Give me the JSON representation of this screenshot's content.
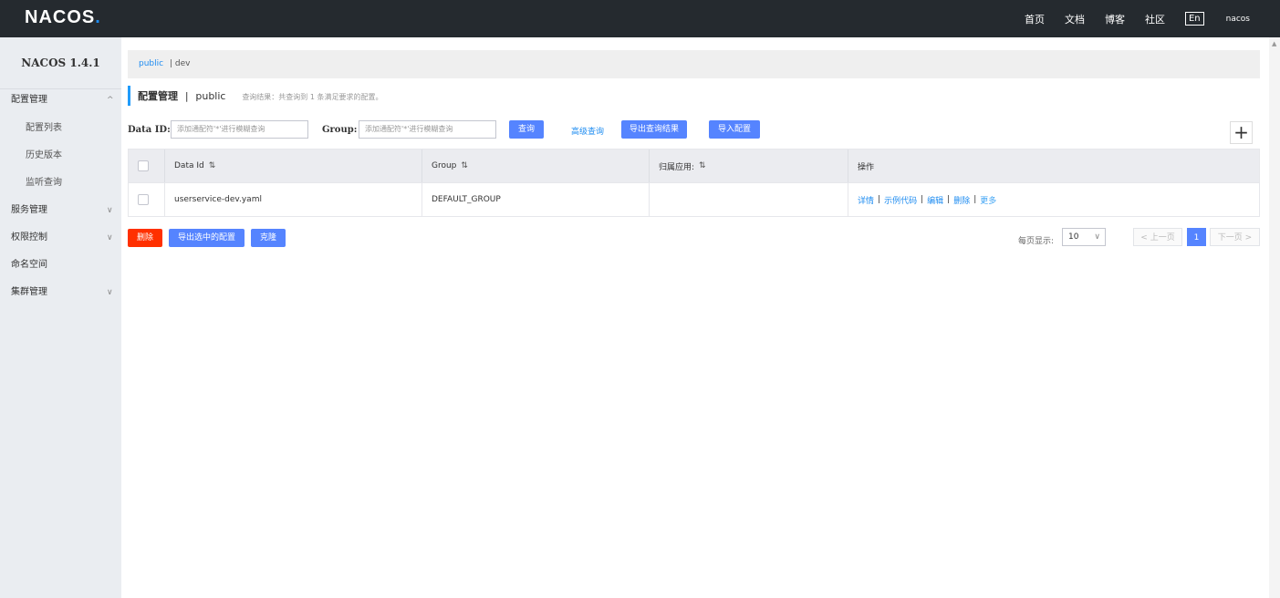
{
  "header": {
    "logo_main": "NACOS",
    "logo_dot": ".",
    "nav": [
      "首页",
      "文档",
      "博客",
      "社区"
    ],
    "lang": "En",
    "user": "nacos"
  },
  "sidebar": {
    "title": "NACOS 1.4.1",
    "items": [
      {
        "label": "配置管理",
        "chevron": "^"
      },
      {
        "label": "配置列表"
      },
      {
        "label": "历史版本"
      },
      {
        "label": "监听查询"
      },
      {
        "label": "服务管理",
        "chevron": "v"
      },
      {
        "label": "权限控制",
        "chevron": "v"
      },
      {
        "label": "命名空间"
      },
      {
        "label": "集群管理",
        "chevron": "v"
      }
    ]
  },
  "namespaces": {
    "active": "public",
    "other": "| dev"
  },
  "page": {
    "title": "配置管理",
    "separator": "|",
    "namespace": "public",
    "result_text": "查询结果：共查询到 1 条满足要求的配置。"
  },
  "search": {
    "data_id_label": "Data ID:",
    "data_id_placeholder": "添加通配符'*'进行模糊查询",
    "group_label": "Group:",
    "group_placeholder": "添加通配符'*'进行模糊查询",
    "query_button": "查询",
    "advanced_link": "高级查询",
    "export_button": "导出查询结果",
    "import_button": "导入配置",
    "add_button": "+"
  },
  "table": {
    "headers": [
      "Data Id",
      "Group",
      "归属应用:",
      "操作"
    ],
    "sort_icon": "⇅",
    "rows": [
      {
        "data_id": "userservice-dev.yaml",
        "group": "DEFAULT_GROUP",
        "app": "",
        "ops": [
          "详情",
          "示例代码",
          "编辑",
          "删除",
          "更多"
        ]
      }
    ],
    "op_separator": "|"
  },
  "bottom": {
    "delete_button": "删除",
    "export_selected_button": "导出选中的配置",
    "clone_button": "克隆",
    "page_size_label": "每页显示:",
    "page_size": "10",
    "prev": "< 上一页",
    "current_page": "1",
    "next": "下一页 >"
  },
  "colors": {
    "primary": "#5584ff",
    "danger": "#ff3000",
    "link": "#1e8cf1",
    "topbar": "#252a2f",
    "sidebar": "#eaedf1"
  }
}
